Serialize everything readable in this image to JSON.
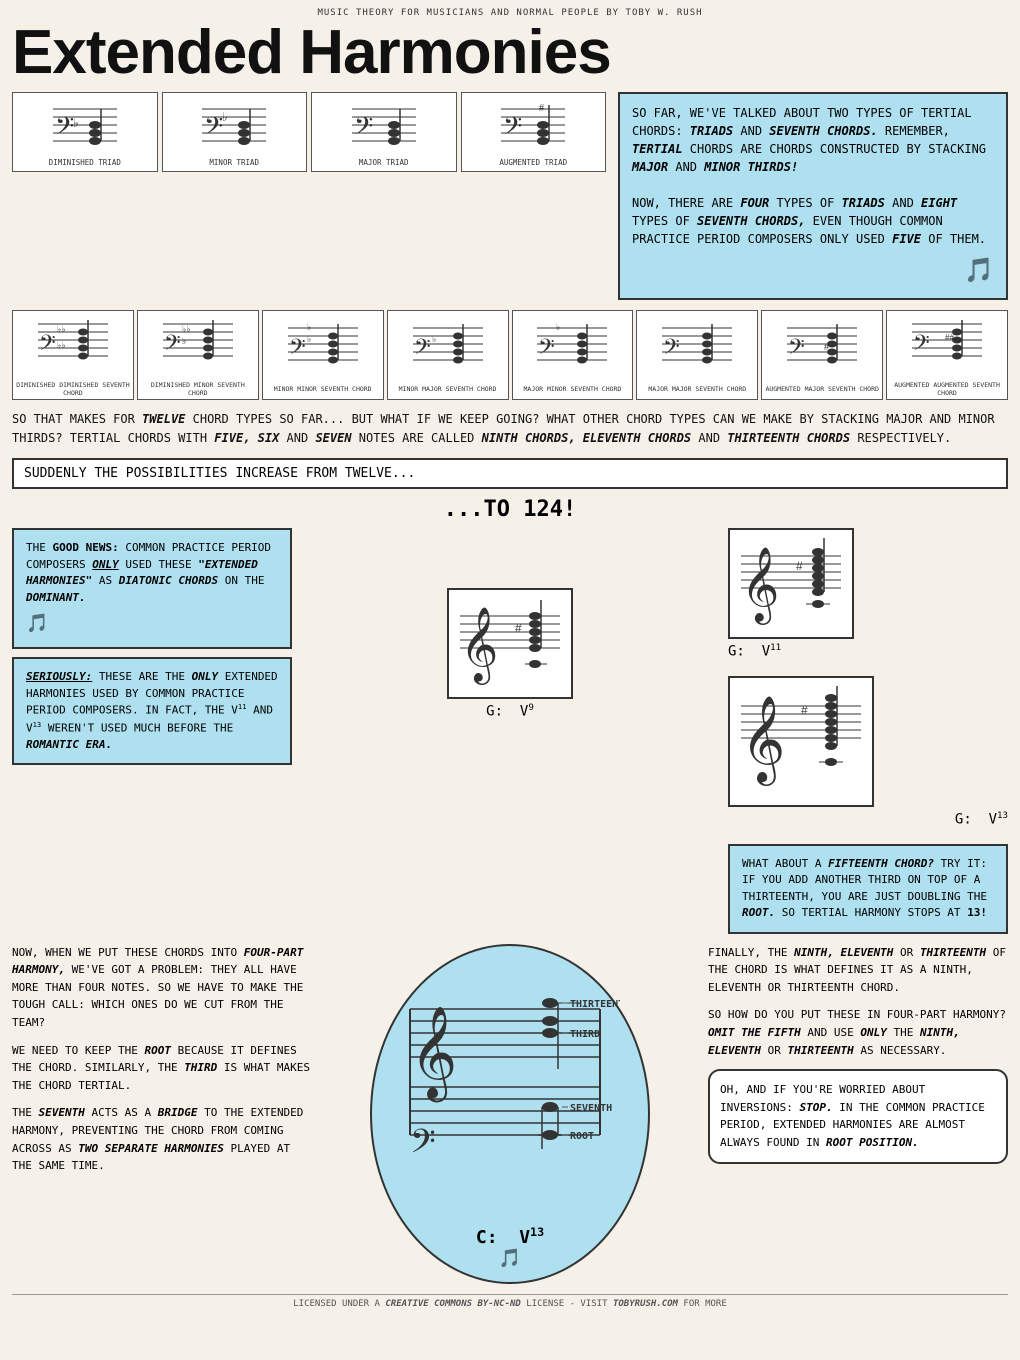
{
  "header": {
    "subtitle": "Music Theory for Musicians and Normal People by Toby W. Rush"
  },
  "title": {
    "main": "Extended Harmonies"
  },
  "intro_text": {
    "paragraph1": "So far, we've talked about two types of tertial chords: TRIADS and SEVENTH CHORDS. Remember, TERTIAL chords are chords constructed by stacking MAJOR and MINOR THIRDS!",
    "paragraph2": "Now, there are FOUR types of TRIADS and EIGHT types of SEVENTH CHORDS, even though common practice period composers only used FIVE of them."
  },
  "triads": [
    {
      "label": "Diminished Triad",
      "notation": "dim"
    },
    {
      "label": "Minor Triad",
      "notation": "min"
    },
    {
      "label": "Major Triad",
      "notation": "maj"
    },
    {
      "label": "Augmented Triad",
      "notation": "aug"
    }
  ],
  "seventh_chords": [
    {
      "label": "Diminished Diminished Seventh Chord"
    },
    {
      "label": "Diminished Minor Seventh Chord"
    },
    {
      "label": "Minor Minor Seventh Chord"
    },
    {
      "label": "Minor Major Seventh Chord"
    },
    {
      "label": "Major Minor Seventh Chord"
    },
    {
      "label": "Major Major Seventh Chord"
    },
    {
      "label": "Augmented Major Seventh Chord"
    },
    {
      "label": "Augmented Augmented Seventh Chord"
    }
  ],
  "body_text1": "So that makes for TWELVE chord types so far... But what if we keep going? What other chord types can we make by stacking major and minor thirds? Tertial chords with FIVE, SIX and SEVEN notes are called NINTH CHORDS, ELEVENTH CHORDS and THIRTEENTH CHORDS respectively.",
  "extended_header": "Suddenly the possibilities increase from twelve...",
  "to_124": "...TO 124!",
  "good_news_box": {
    "text": "The GOOD NEWS: Common practice period composers ONLY used these \"EXTENDED HARMONIES\" as DIATONIC CHORDS on the DOMINANT."
  },
  "seriously_box": {
    "text": "SERIOUSLY: These are the ONLY extended harmonies used by common practice period composers. In fact, the V11 and V13 weren't used much before the ROMANTIC ERA."
  },
  "chords": {
    "v9": "G:  V⁹",
    "v11": "G:  V¹¹",
    "v13": "G:  V¹³"
  },
  "fifteenth_box": {
    "text": "What about a FIFTEENTH CHORD? Try it: if you add another third on top of a thirteenth, you are just doubling the ROOT. So tertial harmony stops at 13!"
  },
  "bottom_left": {
    "p1": "Now, when we put these chords into FOUR-PART HARMONY, we've got a problem: they all have more than four notes. So we have to make the tough call: which ones do we cut from the team?",
    "p2": "We need to keep the ROOT because it defines the chord. Similarly, the THIRD is what makes the chord tertial.",
    "p3": "The SEVENTH acts as a BRIDGE to the extended harmony, preventing the chord from coming across as TWO SEPARATE HARMONIES played at the same time."
  },
  "cv13_label": "C:  V¹³",
  "note_labels": {
    "thirteenth": "THIRTEENTH",
    "third": "THIRD",
    "seventh": "SEVENTH",
    "root": "ROOT"
  },
  "bottom_right": {
    "p1": "Finally, the NINTH, ELEVENTH or THIRTEENTH of the chord is what defines it as a ninth, eleventh or thirteenth chord.",
    "p2": "So how do you put these in four-part harmony? OMIT THE FIFTH and use ONLY the NINTH, ELEVENTH or THIRTEENTH as necessary.",
    "p3": "Oh, and if you're worried about inversions: STOP. In the common practice period, extended harmonies are almost always found in ROOT POSITION."
  },
  "footer": {
    "text": "Licensed under a Creative Commons by-nc-nd license - visit tobyrush.com for more"
  }
}
